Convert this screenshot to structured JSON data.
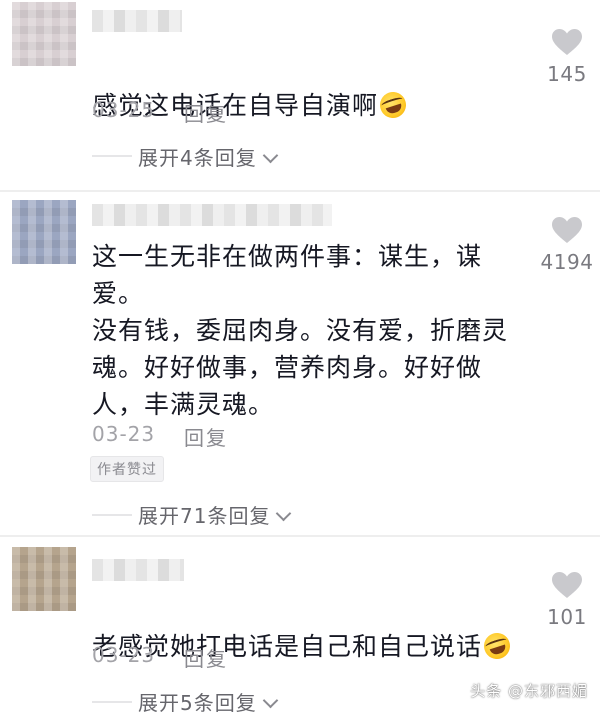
{
  "comments": [
    {
      "text": "感觉这电话在自导自演啊",
      "date": "03-25",
      "reply_label": "回复",
      "likes": "145",
      "expand_label": "展开4条回复",
      "avatar_color": "#d9cfd2",
      "emoji": "rolling-laughing-emoji"
    },
    {
      "text": "这一生无非在做两件事：谋生，谋\n爱。\n没有钱，委屈肉身。没有爱，折磨灵\n魂。好好做事，营养肉身。好好做\n人，丰满灵魂。",
      "date": "03-23",
      "reply_label": "回复",
      "badge": "作者赞过",
      "likes": "4194",
      "expand_label": "展开71条回复",
      "avatar_color": "#9aa6c4"
    },
    {
      "text": "老感觉她打电话是自己和自己说话",
      "date": "03-23",
      "reply_label": "回复",
      "likes": "101",
      "expand_label": "展开5条回复",
      "avatar_color": "#b7a48a",
      "emoji": "rolling-laughing-emoji"
    }
  ],
  "watermark": "头条 @东邪西媚"
}
